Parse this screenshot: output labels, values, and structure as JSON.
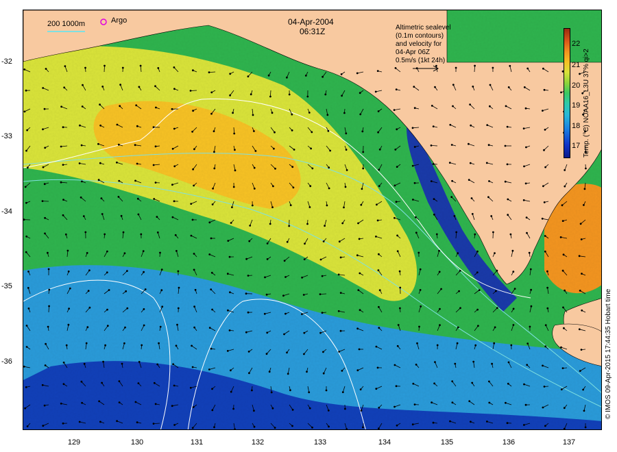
{
  "header": {
    "date": "04-Apr-2004",
    "time": "06:31Z"
  },
  "key": {
    "depth_contours": "200  1000m",
    "argo_label": "Argo",
    "altimetry_lines": [
      "Altimetric sealevel",
      "(0.1m contours)",
      "and velocity for",
      "04-Apr 06Z",
      "0.5m/s (1kt 24h)"
    ]
  },
  "colorbar": {
    "ticks": [
      "22",
      "21",
      "20",
      "19",
      "18",
      "17"
    ],
    "title": "Temp. (°C) NOAA16_L3U 37% qi>2"
  },
  "axes": {
    "lat_labels": [
      "-32",
      "-33",
      "-34",
      "-35",
      "-36"
    ],
    "lon_labels": [
      "129",
      "130",
      "131",
      "132",
      "133",
      "134",
      "135",
      "136",
      "137"
    ]
  },
  "credit": "© IMOS 09-Apr-2015 17:44:35 Hobart time",
  "colors": {
    "land": "#f8c9a0",
    "warm": "#f5c125",
    "mid": "#3cc862",
    "cool": "#1a7ee0",
    "cold": "#0b1a8a",
    "argo_marker": "#e000e0",
    "contour_line": "#7fe0e0"
  }
}
